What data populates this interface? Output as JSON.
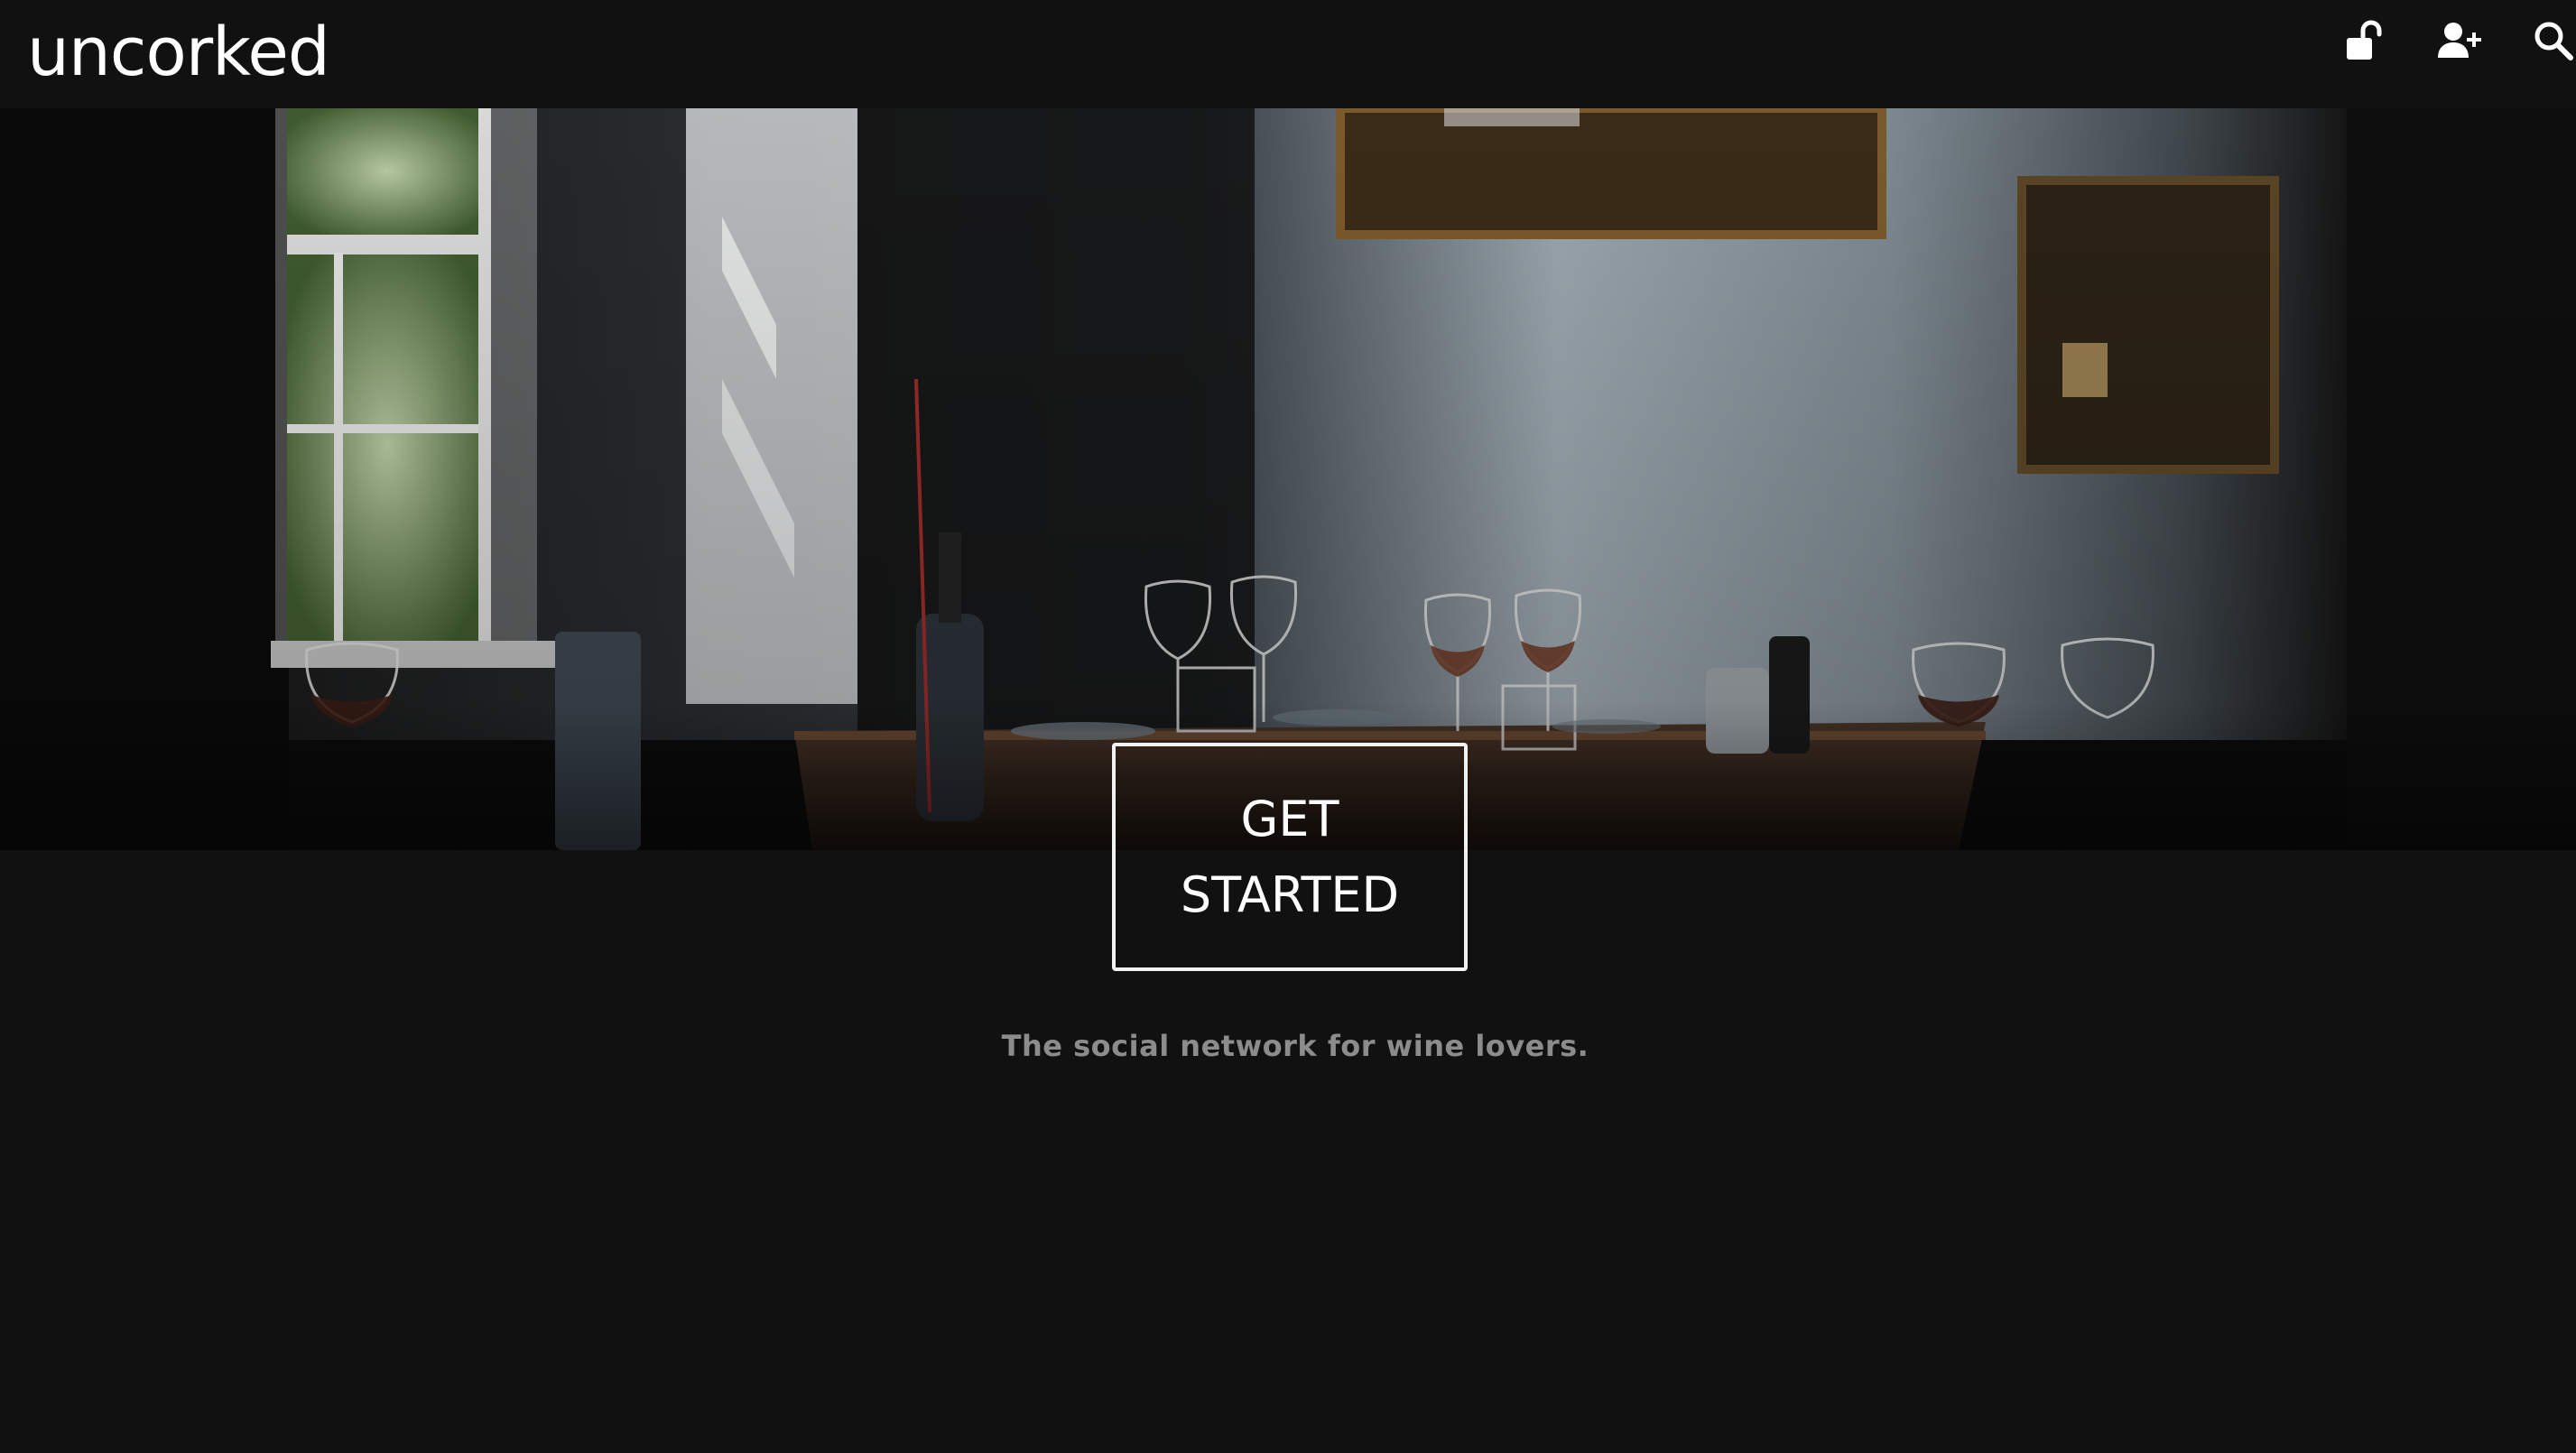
{
  "header": {
    "logo_text": "uncorked",
    "icons": {
      "login": "unlock-icon",
      "signup": "user-plus-icon",
      "search": "search-icon"
    }
  },
  "hero": {
    "image_alt": "dim restaurant interior with wine glasses on a wooden table",
    "cta_label": "GET STARTED"
  },
  "tagline": "The social network for wine lovers.",
  "colors": {
    "background": "#111111",
    "text": "#ffffff",
    "tagline": "#8c8c8c"
  }
}
